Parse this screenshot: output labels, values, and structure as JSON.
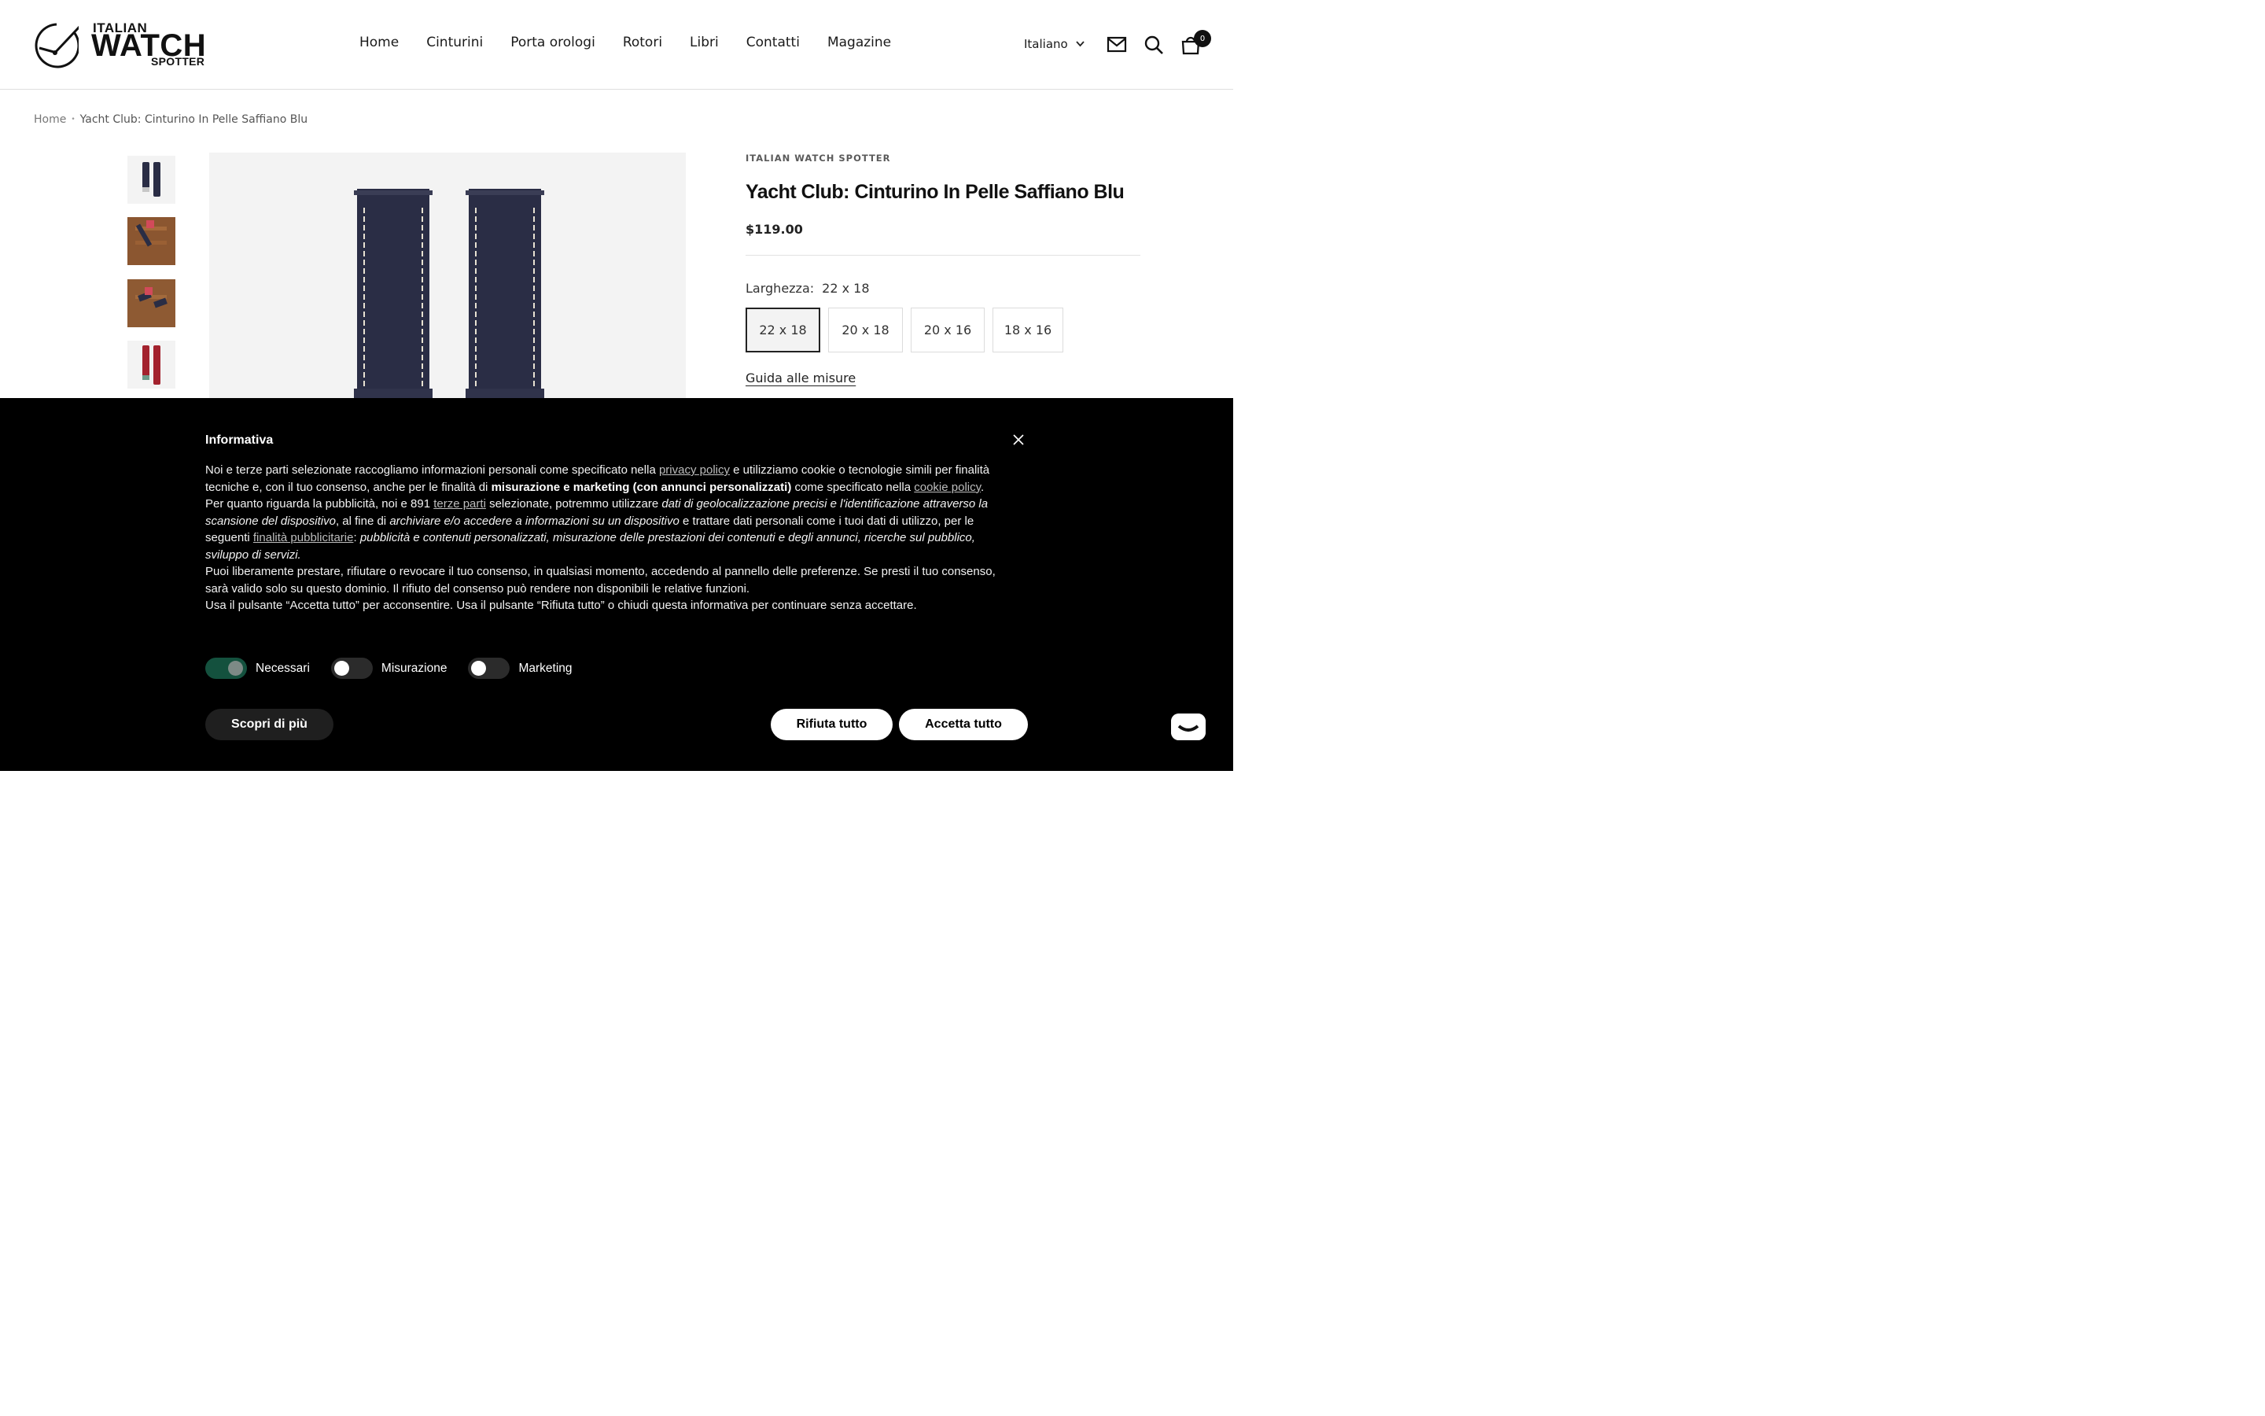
{
  "header": {
    "logo": {
      "line1": "ITALIAN",
      "line2": "WATCH",
      "line3": "SPOTTER"
    },
    "nav": [
      "Home",
      "Cinturini",
      "Porta orologi",
      "Rotori",
      "Libri",
      "Contatti",
      "Magazine"
    ],
    "language": "Italiano",
    "cart_count": "0",
    "icons": [
      "mail-icon",
      "search-icon",
      "cart-icon"
    ]
  },
  "breadcrumb": {
    "home": "Home",
    "current": "Yacht Club: Cinturino In Pelle Saffiano Blu"
  },
  "product": {
    "vendor": "ITALIAN WATCH SPOTTER",
    "title": "Yacht Club: Cinturino In Pelle Saffiano Blu",
    "price": "$119.00",
    "option_label": "Larghezza:",
    "option_selected": "22 x 18",
    "sizes": [
      "22 x 18",
      "20 x 18",
      "20 x 16",
      "18 x 16"
    ],
    "size_guide": "Guida alle misure",
    "colors": {
      "strap": "#2a2d45",
      "stitch": "#e8e2d2"
    }
  },
  "cookie": {
    "title": "Informativa",
    "p1_a": "Noi e terze parti selezionate raccogliamo informazioni personali come specificato nella ",
    "p1_link": "privacy policy",
    "p1_b": " e utilizziamo cookie o tecnologie simili per finalità tecniche e, con il tuo consenso, anche per le finalità di ",
    "p1_bold": "misurazione e marketing (con annunci personalizzati)",
    "p1_c": " come specificato nella ",
    "p1_link2": "cookie policy",
    "p1_d": ".",
    "p2_a": "Per quanto riguarda la pubblicità, noi e 891 ",
    "p2_link": "terze parti",
    "p2_b": " selezionate, potremmo utilizzare ",
    "p2_i1": "dati di geolocalizzazione precisi e l'identificazione attraverso la scansione del dispositivo",
    "p2_c": ", al fine di ",
    "p2_i2": "archiviare e/o accedere a informazioni su un dispositivo",
    "p2_d": " e trattare dati personali come i tuoi dati di utilizzo, per le seguenti ",
    "p2_link2": "finalità pubblicitarie",
    "p2_e": ": ",
    "p2_i3": "pubblicità e contenuti personalizzati, misurazione delle prestazioni dei contenuti e degli annunci, ricerche sul pubblico, sviluppo di servizi.",
    "p3": "Puoi liberamente prestare, rifiutare o revocare il tuo consenso, in qualsiasi momento, accedendo al pannello delle preferenze. Se presti il tuo consenso, sarà valido solo su questo dominio. Il rifiuto del consenso può rendere non disponibili le relative funzioni.",
    "p4": "Usa il pulsante “Accetta tutto” per acconsentire. Usa il pulsante “Rifiuta tutto” o chiudi questa informativa per continuare senza accettare.",
    "toggles": [
      {
        "label": "Necessari",
        "on": true
      },
      {
        "label": "Misurazione",
        "on": false
      },
      {
        "label": "Marketing",
        "on": false
      }
    ],
    "btn_more": "Scopri di più",
    "btn_reject": "Rifiuta tutto",
    "btn_accept": "Accetta tutto"
  }
}
